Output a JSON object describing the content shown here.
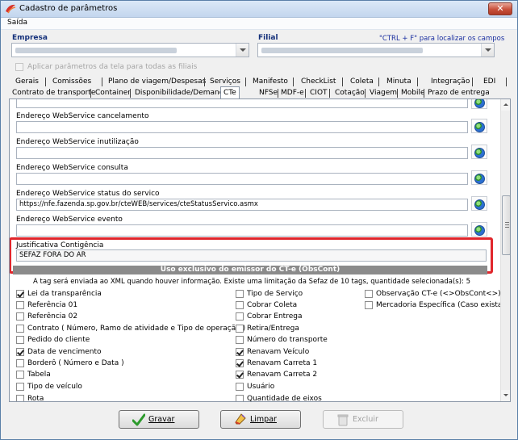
{
  "window": {
    "title": "Cadastro de parâmetros",
    "close_symbol": "✕"
  },
  "menu": {
    "items": [
      "Saída"
    ]
  },
  "header": {
    "empresa_label": "Empresa",
    "filial_label": "Filial",
    "search_hint": "\"CTRL + F\" para localizar os campos",
    "apply_all_label": "Aplicar parâmetros da tela para todas as filiais"
  },
  "tabs_row1": [
    "Gerais",
    "Comissões",
    "Plano de viagem/Despesas",
    "Serviços",
    "Manifesto",
    "CheckList",
    "Coleta",
    "Minuta",
    "Integração",
    "EDI"
  ],
  "tabs_row2": [
    "Contrato de transporte",
    "Container",
    "Disponibilidade/Demanda",
    "CTe",
    "NFSe",
    "MDF-e",
    "CIOT",
    "Cotação",
    "Viagem",
    "Mobile",
    "Prazo de entrega"
  ],
  "active_tab": "CTe",
  "fields": [
    {
      "label": "Endereço WebService cancelamento",
      "value": ""
    },
    {
      "label": "Endereço WebService inutilização",
      "value": ""
    },
    {
      "label": "Endereço WebService consulta",
      "value": ""
    },
    {
      "label": "Endereço WebService status do servico",
      "value": "https://nfe.fazenda.sp.gov.br/cteWEB/services/cteStatusServico.asmx"
    },
    {
      "label": "Endereço WebService evento",
      "value": ""
    }
  ],
  "contingencia": {
    "label": "Justificativa Contigência",
    "value": "SEFAZ FORA DO AR"
  },
  "obscont": {
    "title": "Uso exclusivo do emissor do CT-e (ObsCont)",
    "info": "A tag será enviada ao XML quando houver informação. Existe uma limitação da Sefaz de 10 tags, quantidade selecionada(s): 5",
    "col1": [
      {
        "label": "Lei da transparência",
        "checked": true
      },
      {
        "label": "Referência 01",
        "checked": false
      },
      {
        "label": "Referência 02",
        "checked": false
      },
      {
        "label": "Contrato ( Número, Ramo de atividade e Tipo de operação )",
        "checked": false
      },
      {
        "label": "Pedido do cliente",
        "checked": false
      },
      {
        "label": "Data de vencimento",
        "checked": true
      },
      {
        "label": "Borderô ( Número e Data )",
        "checked": false
      },
      {
        "label": "Tabela",
        "checked": false
      },
      {
        "label": "Tipo de veículo",
        "checked": false
      },
      {
        "label": "Rota",
        "checked": false
      }
    ],
    "col2": [
      {
        "label": "Tipo de Serviço",
        "checked": false
      },
      {
        "label": "Cobrar Coleta",
        "checked": false
      },
      {
        "label": "Cobrar Entrega",
        "checked": false
      },
      {
        "label": "Retira/Entrega",
        "checked": false
      },
      {
        "label": "Número do transporte",
        "checked": false
      },
      {
        "label": "Renavam Veículo",
        "checked": true
      },
      {
        "label": "Renavam Carreta 1",
        "checked": true
      },
      {
        "label": "Renavam Carreta 2",
        "checked": true
      },
      {
        "label": "Usuário",
        "checked": false
      },
      {
        "label": "Quantidade de eixos",
        "checked": false
      }
    ],
    "col3": [
      {
        "label": "Observação CT-e (<>ObsCont<>)",
        "checked": false
      },
      {
        "label": "Mercadoria Específica (Caso exista)",
        "checked": false
      }
    ]
  },
  "buttons": {
    "save": "Gravar",
    "clear": "Limpar",
    "delete": "Excluir"
  },
  "colors": {
    "highlight": "#e0262c",
    "accent_text": "#14307a",
    "link_hint": "#1a2fa0"
  }
}
